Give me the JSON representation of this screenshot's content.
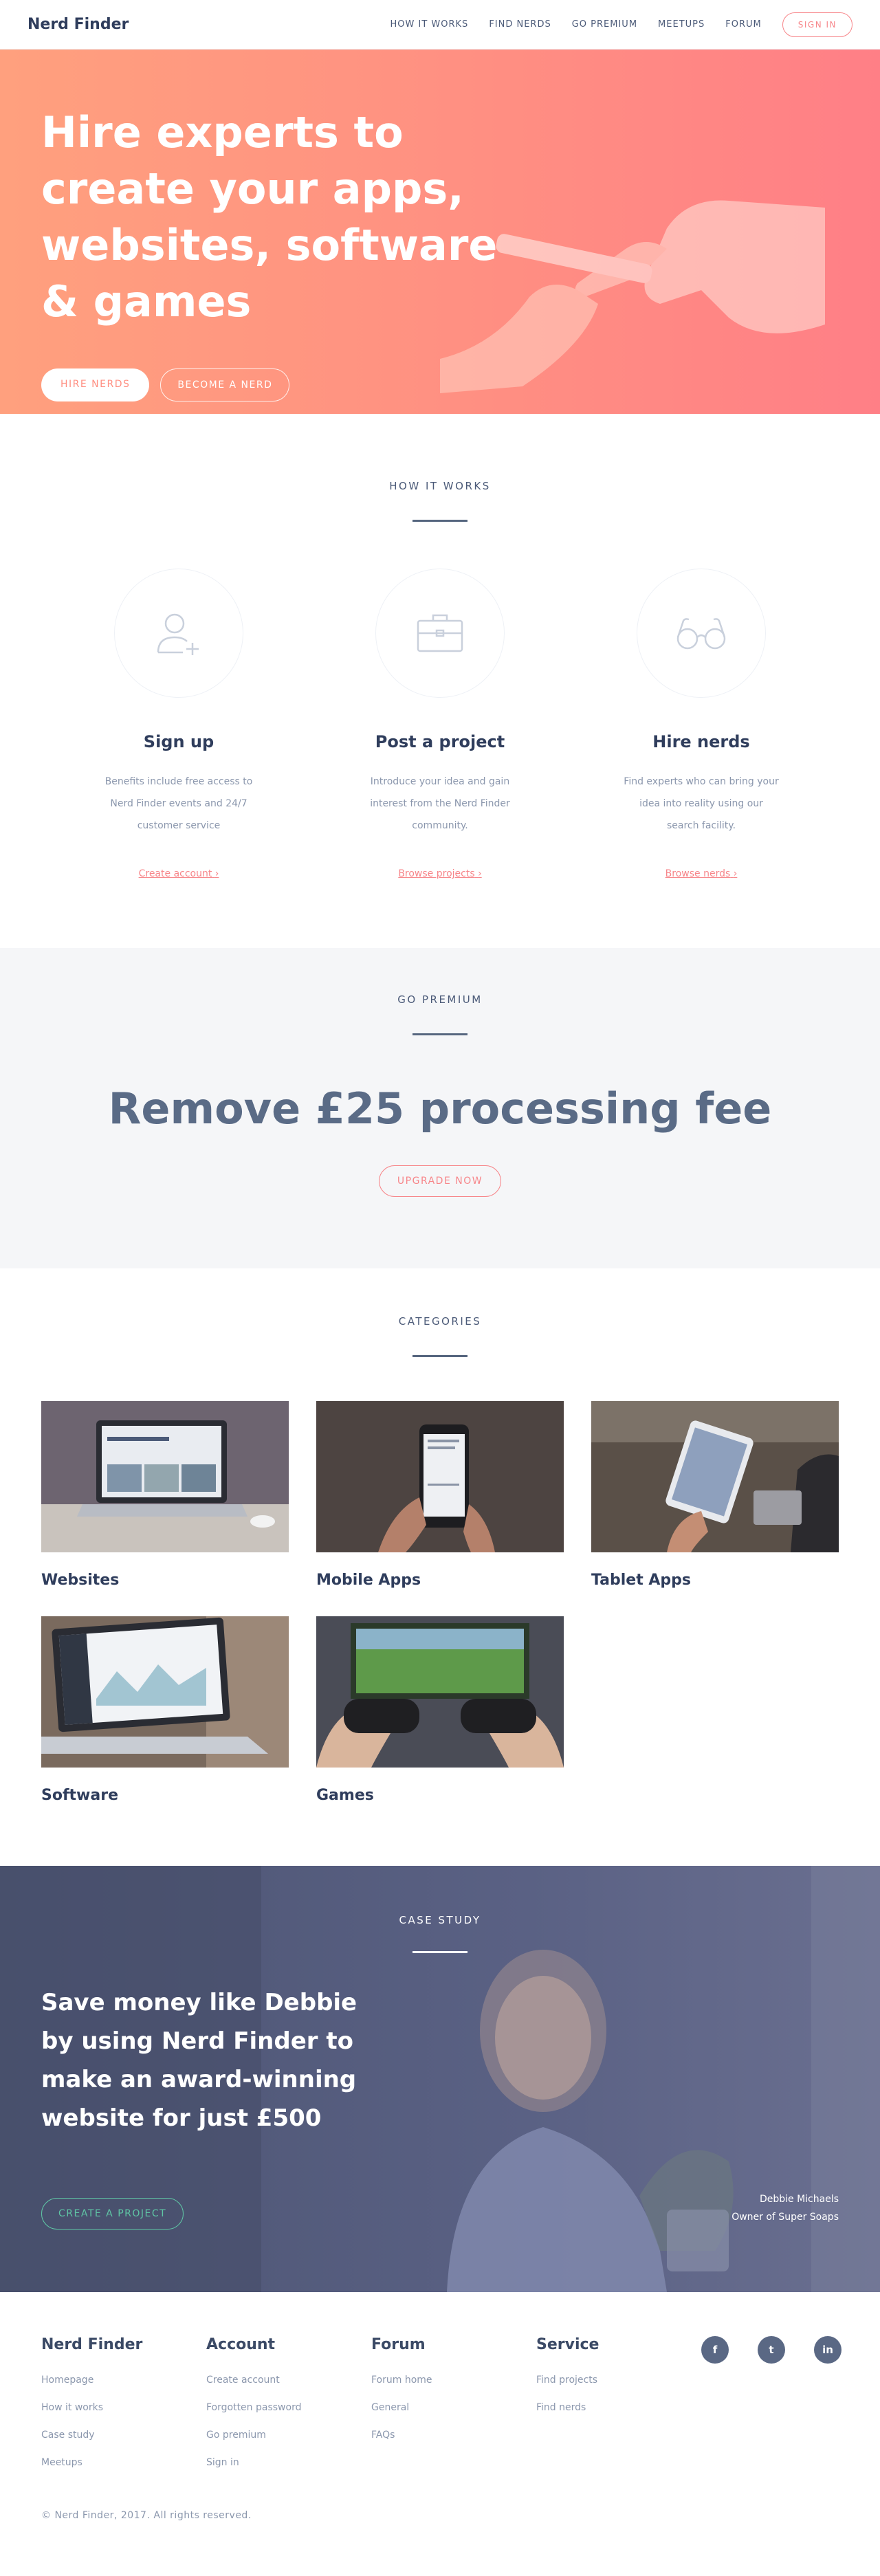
{
  "nav": {
    "logo": "Nerd Finder",
    "links": [
      "HOW IT WORKS",
      "FIND NERDS",
      "GO PREMIUM",
      "MEETUPS",
      "FORUM"
    ],
    "signin": "SIGN IN"
  },
  "hero": {
    "title": "Hire experts to create your apps, websites, software & games",
    "primary_button": "HIRE NERDS",
    "secondary_button": "BECOME A NERD"
  },
  "how": {
    "label": "HOW IT WORKS",
    "steps": [
      {
        "title": "Sign up",
        "text": "Benefits include free access to Nerd Finder events and 24/7 customer service",
        "link": "Create account",
        "icon": "add-user-icon"
      },
      {
        "title": "Post a project",
        "text": "Introduce your idea and gain interest from the Nerd Finder community.",
        "link": "Browse projects",
        "icon": "briefcase-icon"
      },
      {
        "title": "Hire nerds",
        "text": "Find experts who can bring your idea into reality using our search facility.",
        "link": "Browse nerds",
        "icon": "glasses-icon"
      }
    ]
  },
  "premium": {
    "label": "GO PREMIUM",
    "headline": "Remove £25 processing fee",
    "button": "UPGRADE NOW"
  },
  "categories": {
    "label": "CATEGORIES",
    "items": [
      "Websites",
      "Mobile Apps",
      "Tablet Apps",
      "Software",
      "Games"
    ]
  },
  "case_study": {
    "label": "CASE STUDY",
    "title": "Save money like Debbie by using Nerd Finder to make an award-winning website for just £500",
    "button": "CREATE A PROJECT",
    "person_name": "Debbie Michaels",
    "person_role": "Owner of Super Soaps"
  },
  "footer": {
    "columns": [
      {
        "title": "Nerd Finder",
        "links": [
          "Homepage",
          "How it works",
          "Case study",
          "Meetups"
        ]
      },
      {
        "title": "Account",
        "links": [
          "Create account",
          "Forgotten password",
          "Go premium",
          "Sign in"
        ]
      },
      {
        "title": "Forum",
        "links": [
          "Forum home",
          "General",
          "FAQs"
        ]
      },
      {
        "title": "Service",
        "links": [
          "Find projects",
          "Find nerds"
        ]
      }
    ],
    "socials": [
      {
        "glyph": "f",
        "icon": "facebook-icon"
      },
      {
        "glyph": "t",
        "icon": "twitter-icon"
      },
      {
        "glyph": "in",
        "icon": "linkedin-icon"
      }
    ],
    "copyright": "© Nerd Finder, 2017. All rights reserved."
  },
  "colors": {
    "coral": "#f7868a",
    "navy": "#2f3d5c",
    "green": "#5fc6a5"
  }
}
